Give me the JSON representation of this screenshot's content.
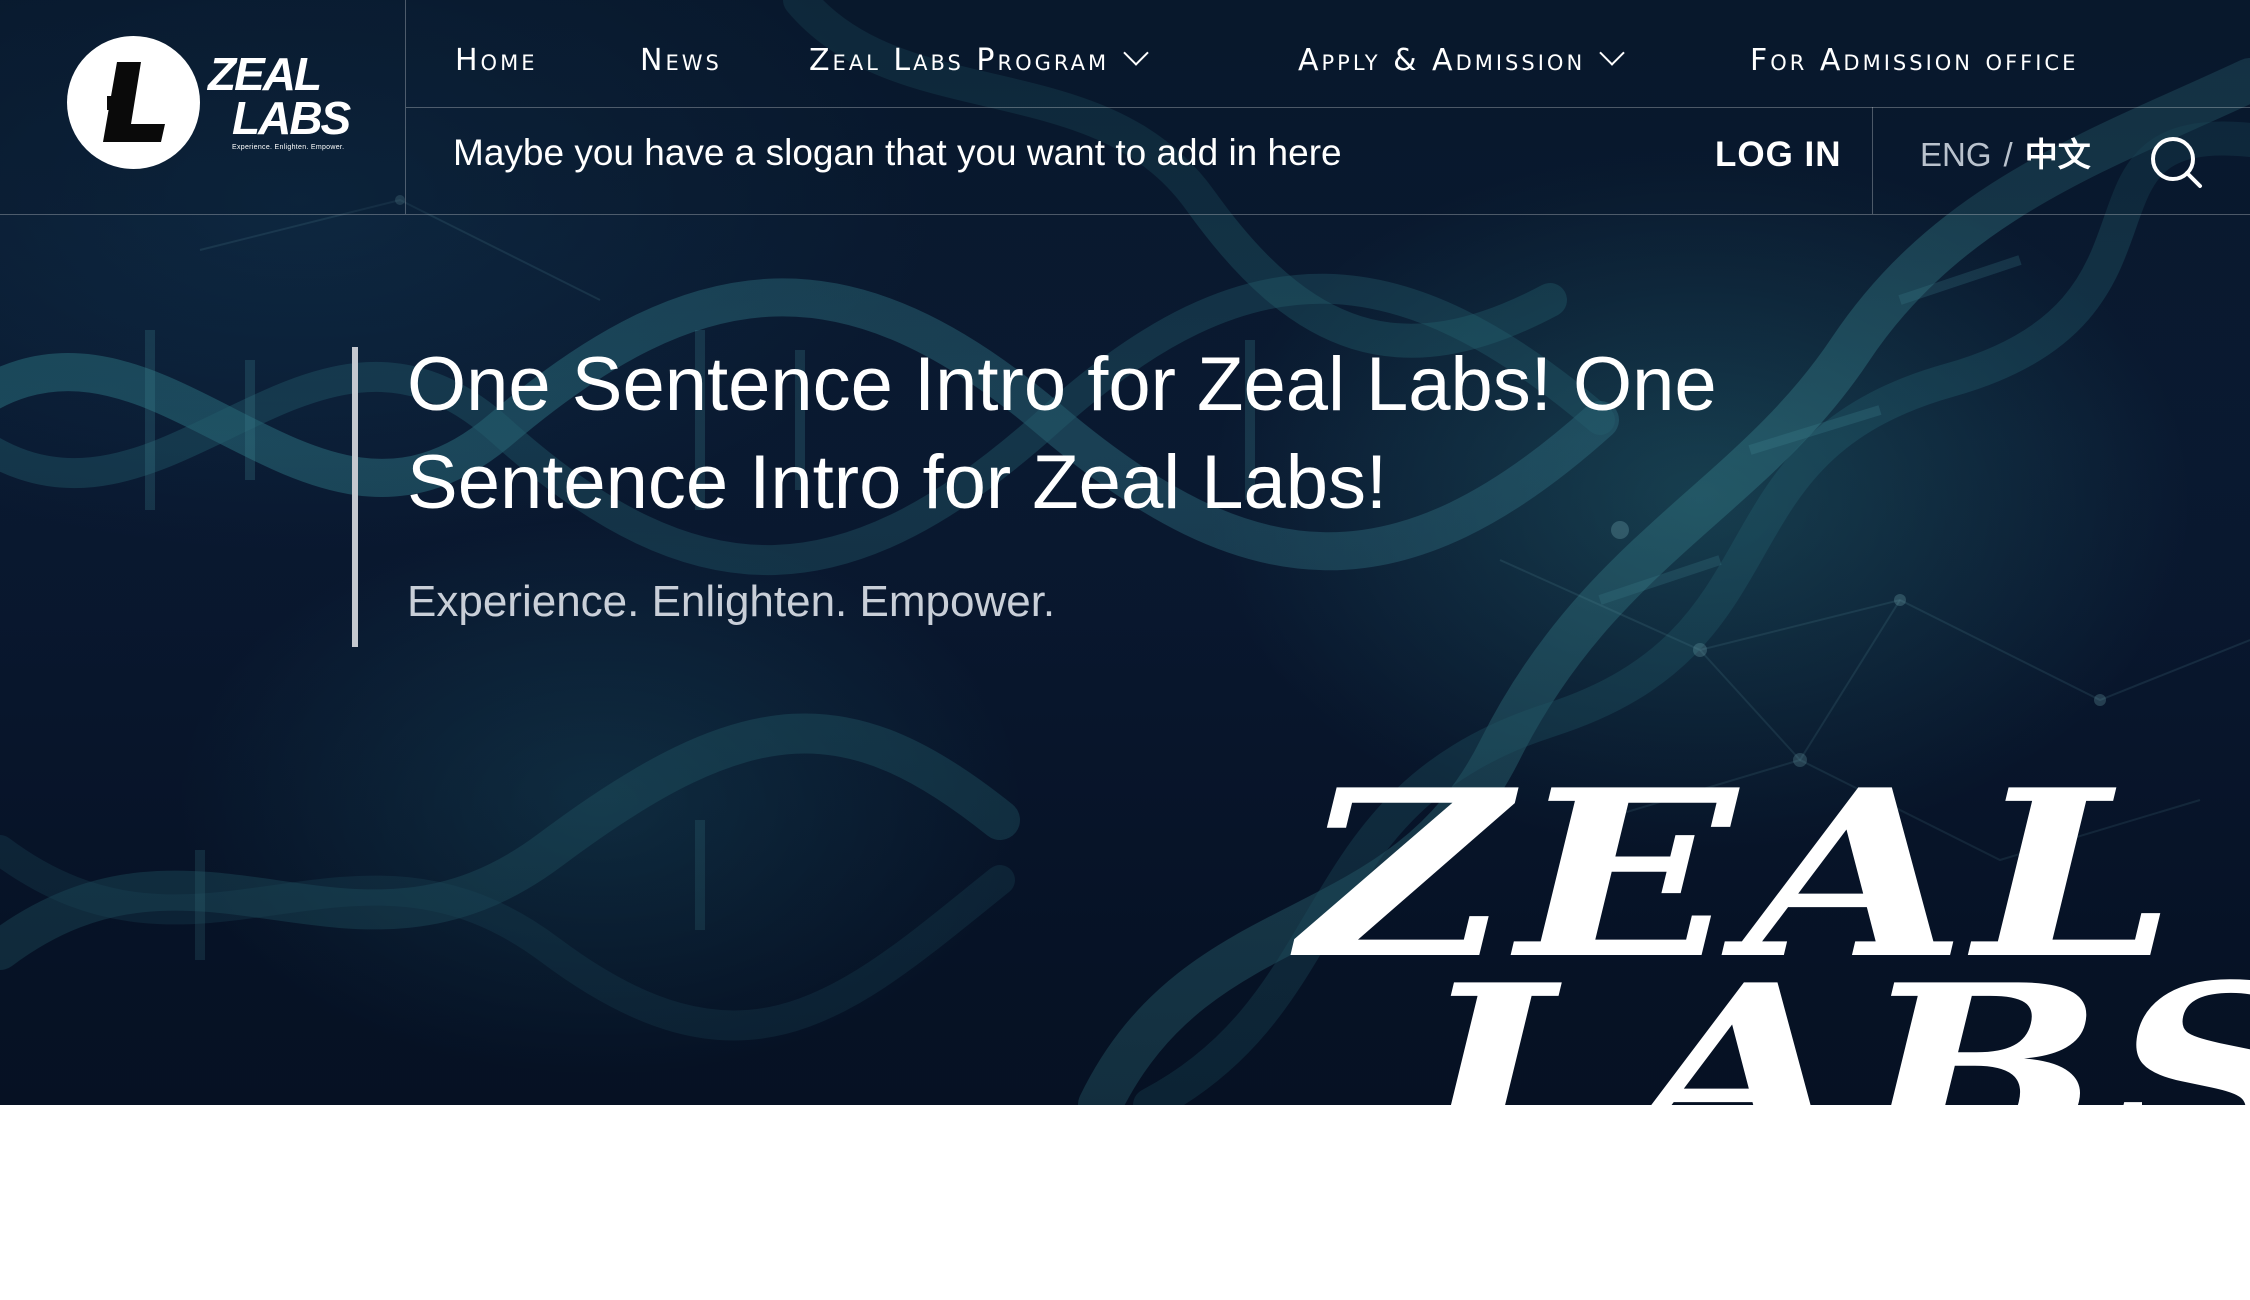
{
  "logo": {
    "word_line1": "ZEAL",
    "word_line2": "LABS",
    "tagline": "Experience. Enlighten. Empower."
  },
  "nav": {
    "items": [
      {
        "label": "Home",
        "has_dropdown": false
      },
      {
        "label": "News",
        "has_dropdown": false
      },
      {
        "label": "Zeal Labs Program",
        "has_dropdown": true
      },
      {
        "label": "Apply & Admission",
        "has_dropdown": true
      },
      {
        "label": "For Admission office",
        "has_dropdown": false
      }
    ]
  },
  "header": {
    "slogan": "Maybe you have a slogan that you want to add in here",
    "login_label": "LOG IN",
    "lang_eng": "ENG",
    "lang_sep": "/",
    "lang_zh": "中文",
    "search_icon": "search-icon"
  },
  "hero": {
    "title": "One Sentence Intro for Zeal Labs! One Sentence Intro for Zeal Labs!",
    "subtitle": "Experience. Enlighten. Empower.",
    "big_word_1": "ZEAL",
    "big_word_2": "LABS",
    "background": "dna-helix-image"
  },
  "colors": {
    "hero_bg": "#0a1a33",
    "text": "#ffffff",
    "muted_text": "#c9cfd8",
    "page_bg": "#ffffff"
  }
}
